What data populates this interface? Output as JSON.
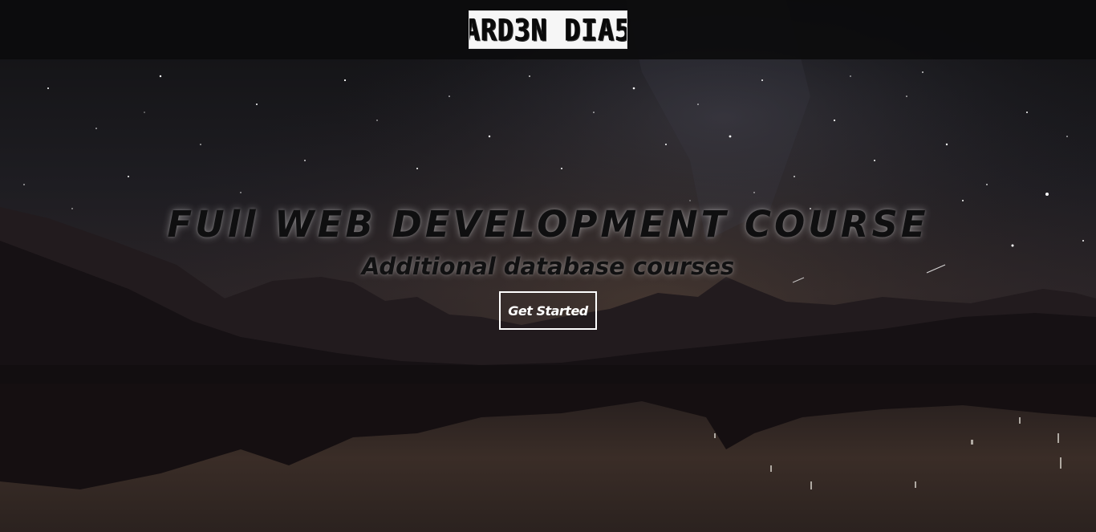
{
  "navbar": {
    "logo_text": "ARD3N DIA5"
  },
  "hero": {
    "title": "FUll WEB DEVELOPMENT COURSE",
    "subtitle": "Additional database courses",
    "cta_label": "Get Started"
  },
  "colors": {
    "navbar_bg": "#0c0c0d",
    "sky_dark": "#141317",
    "mountain": "#1b1518",
    "lake_reflection": "#2a2220",
    "button_border": "#ffffff",
    "title_text": "#0f0f10"
  },
  "icons": {
    "background": "night-sky-mountain-lake-image"
  }
}
